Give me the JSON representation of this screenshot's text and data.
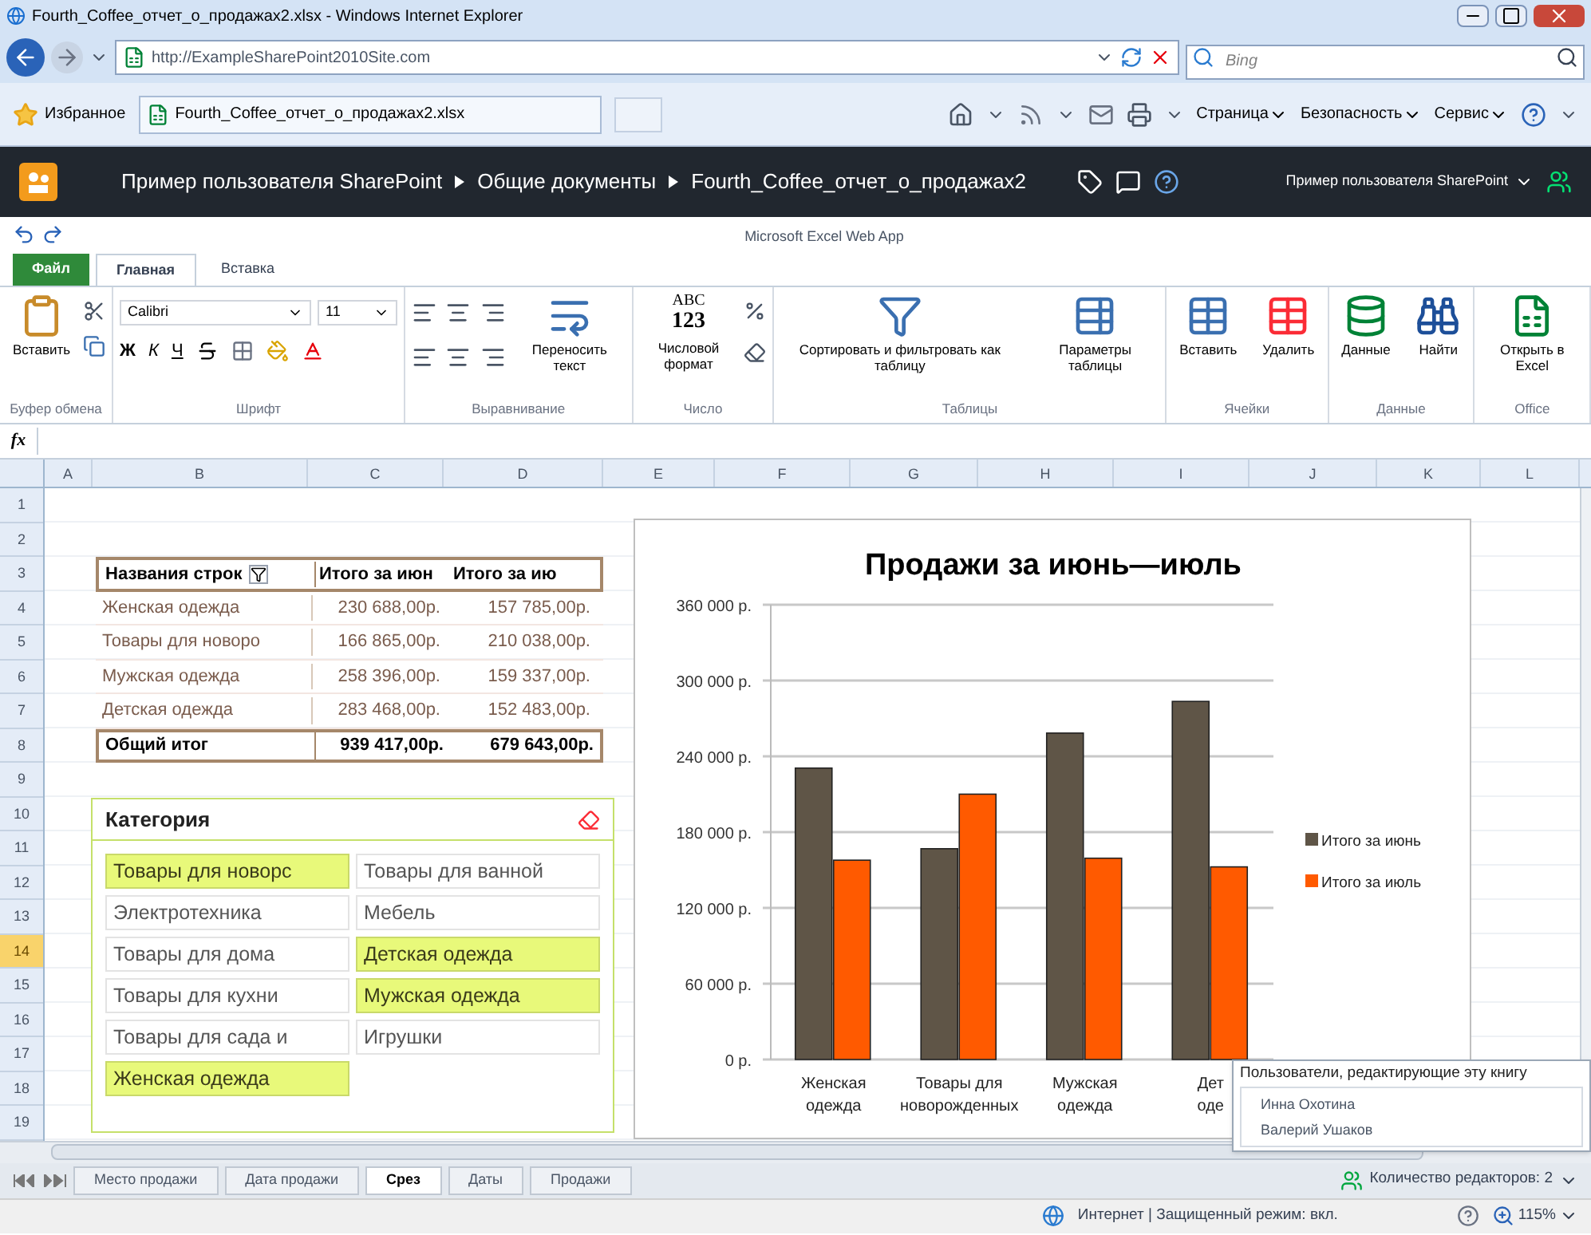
{
  "browser": {
    "title": "Fourth_Coffee_отчет_о_продажах2.xlsx - Windows Internet Explorer",
    "address": "http://ExampleSharePoint2010Site.com",
    "search_placeholder": "Bing",
    "favorites_label": "Избранное",
    "tab": "Fourth_Coffee_отчет_о_продажах2.xlsx",
    "commands": [
      "Страница",
      "Безопасность",
      "Сервис"
    ]
  },
  "sharepoint": {
    "breadcrumb": [
      "Пример пользователя SharePoint",
      "Общие документы",
      "Fourth_Coffee_отчет_о_продажах2"
    ],
    "user": "Пример пользователя SharePoint"
  },
  "app_title": "Microsoft Excel Web App",
  "ribbon_tabs": [
    {
      "label": "Файл",
      "kind": "file",
      "selected": false
    },
    {
      "label": "Главная",
      "kind": "tab",
      "selected": true
    },
    {
      "label": "Вставка",
      "kind": "tab",
      "selected": false
    }
  ],
  "ribbon_groups": [
    {
      "kind": "clipboard",
      "label": "Буфер обмена",
      "buttons": [
        "Вставить"
      ]
    },
    {
      "kind": "font",
      "label": "Шрифт",
      "font_name": "Calibri",
      "font_size": "11",
      "letters": [
        "Ж",
        "К",
        "Ч"
      ]
    },
    {
      "kind": "alignment",
      "label": "Выравнивание",
      "buttons": [
        "Переносить текст"
      ]
    },
    {
      "kind": "number",
      "label": "Число",
      "icon_text": [
        "ABC",
        "123"
      ],
      "buttons": [
        "Числовой формат"
      ]
    },
    {
      "kind": "tables",
      "label": "Таблицы",
      "buttons": [
        "Сортировать и фильтровать как таблицу",
        "Параметры таблицы"
      ]
    },
    {
      "kind": "cells",
      "label": "Ячейки",
      "buttons": [
        "Вставить",
        "Удалить"
      ]
    },
    {
      "kind": "data",
      "label": "Данные",
      "buttons": [
        "Данные",
        "Найти"
      ]
    },
    {
      "kind": "office",
      "label": "Office",
      "buttons": [
        "Открыть в Excel"
      ]
    }
  ],
  "formula_label": "fx",
  "sheet": {
    "columns": [
      "A",
      "B",
      "C",
      "D",
      "E",
      "F",
      "G",
      "H",
      "I",
      "J",
      "K",
      "L"
    ],
    "rows": [
      {
        "label": "1",
        "selected": false
      },
      {
        "label": "2",
        "selected": false
      },
      {
        "label": "3",
        "selected": false
      },
      {
        "label": "4",
        "selected": false
      },
      {
        "label": "5",
        "selected": false
      },
      {
        "label": "6",
        "selected": false
      },
      {
        "label": "7",
        "selected": false
      },
      {
        "label": "8",
        "selected": false
      },
      {
        "label": "9",
        "selected": false
      },
      {
        "label": "10",
        "selected": false
      },
      {
        "label": "11",
        "selected": false
      },
      {
        "label": "12",
        "selected": false
      },
      {
        "label": "13",
        "selected": false
      },
      {
        "label": "14",
        "selected": true
      },
      {
        "label": "15",
        "selected": false
      },
      {
        "label": "16",
        "selected": false
      },
      {
        "label": "17",
        "selected": false
      },
      {
        "label": "18",
        "selected": false
      },
      {
        "label": "19",
        "selected": false
      }
    ]
  },
  "pivot": {
    "columns": [
      "Названия строк",
      "Итого за июн",
      "Итого за ию"
    ],
    "rows": [
      {
        "label": "Женская одежда",
        "june": "230 688,00р.",
        "july": "157 785,00р."
      },
      {
        "label": "Товары для новоро",
        "june": "166 865,00р.",
        "july": "210 038,00р."
      },
      {
        "label": "Мужская одежда",
        "june": "258 396,00р.",
        "july": "159 337,00р."
      },
      {
        "label": "Детская одежда",
        "june": "283 468,00р.",
        "july": "152 483,00р."
      }
    ],
    "total": {
      "label": "Общий итог",
      "june": "939 417,00р.",
      "july": "679 643,00р."
    }
  },
  "slicer": {
    "title": "Категория",
    "items": [
      {
        "label": "Товары для новорс",
        "selected": true
      },
      {
        "label": "Товары для ванной",
        "selected": false
      },
      {
        "label": "Электротехника",
        "selected": false
      },
      {
        "label": "Мебель",
        "selected": false
      },
      {
        "label": "Товары для дома",
        "selected": false
      },
      {
        "label": "Детская одежда",
        "selected": true
      },
      {
        "label": "Товары для кухни",
        "selected": false
      },
      {
        "label": "Мужская одежда",
        "selected": true
      },
      {
        "label": "Товары для сада и",
        "selected": false
      },
      {
        "label": "Игрушки",
        "selected": false
      },
      {
        "label": "Женская одежда",
        "selected": true
      }
    ]
  },
  "chart": {
    "chart_data": {
      "type": "bar",
      "title": "Продажи за июнь—июль",
      "categories": [
        "Женская одежда",
        "Товары для новорожденных",
        "Мужская одежда",
        "Дет оде"
      ],
      "series": [
        {
          "name": "Итого за июнь",
          "color": "#5f5547",
          "values": [
            230688,
            166865,
            258396,
            283468
          ]
        },
        {
          "name": "Итого за июль",
          "color": "#ff5a00",
          "values": [
            157785,
            210038,
            159337,
            152483
          ]
        }
      ],
      "grid": true,
      "legend": true,
      "ylim": [
        0,
        360000
      ],
      "yticks": [
        {
          "value": 0,
          "label": "0 р."
        },
        {
          "value": 60000,
          "label": "60 000 р."
        },
        {
          "value": 120000,
          "label": "120 000 р."
        },
        {
          "value": 180000,
          "label": "180 000 р."
        },
        {
          "value": 240000,
          "label": "240 000 р."
        },
        {
          "value": 300000,
          "label": "300 000 р."
        },
        {
          "value": 360000,
          "label": "360 000 р."
        }
      ]
    }
  },
  "sheet_tabs": [
    {
      "label": "Место продажи",
      "selected": false
    },
    {
      "label": "Дата продажи",
      "selected": false
    },
    {
      "label": "Срез",
      "selected": true
    },
    {
      "label": "Даты",
      "selected": false
    },
    {
      "label": "Продажи",
      "selected": false
    }
  ],
  "editors_count": "Количество редакторов: 2",
  "editors_popup": {
    "title": "Пользователи, редактирующие эту книгу",
    "users": [
      "Инна Охотина",
      "Валерий Ушаков"
    ]
  },
  "status": {
    "zone": "Интернет | Защищенный режим: вкл.",
    "zoom": "115%"
  }
}
